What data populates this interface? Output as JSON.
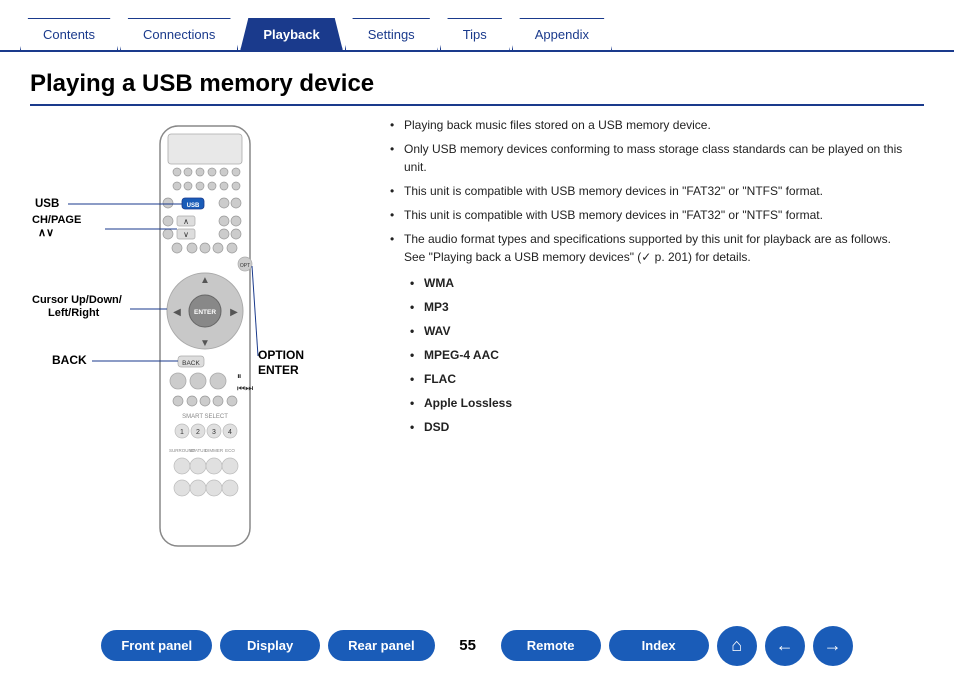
{
  "nav": {
    "tabs": [
      {
        "label": "Contents",
        "active": false
      },
      {
        "label": "Connections",
        "active": false
      },
      {
        "label": "Playback",
        "active": true
      },
      {
        "label": "Settings",
        "active": false
      },
      {
        "label": "Tips",
        "active": false
      },
      {
        "label": "Appendix",
        "active": false
      }
    ]
  },
  "page": {
    "title": "Playing a USB memory device",
    "page_number": "55"
  },
  "diagram": {
    "labels": {
      "usb": "USB",
      "ch_page": "CH/PAGE ∧∨",
      "cursor": "Cursor Up/Down/\nLeft/Right",
      "back": "BACK",
      "option_enter": "OPTION\nENTER"
    }
  },
  "bullets": [
    "Playing back music files stored on a USB memory device.",
    "Only USB memory devices conforming to mass storage class standards can be played on this unit.",
    "This unit is compatible with USB memory devices in \"FAT32\" or \"NTFS\" format.",
    "The audio format types and specifications supported by this unit for playback are as follows.\nSee \"Playing back a USB memory devices\" (☞ p. 201) for details."
  ],
  "formats": [
    "WMA",
    "MP3",
    "WAV",
    "MPEG-4 AAC",
    "FLAC",
    "Apple Lossless",
    "DSD"
  ],
  "bottom": {
    "front_panel": "Front panel",
    "display": "Display",
    "rear_panel": "Rear panel",
    "page_num": "55",
    "remote": "Remote",
    "index": "Index",
    "home_icon": "⌂",
    "back_icon": "←",
    "forward_icon": "→"
  }
}
